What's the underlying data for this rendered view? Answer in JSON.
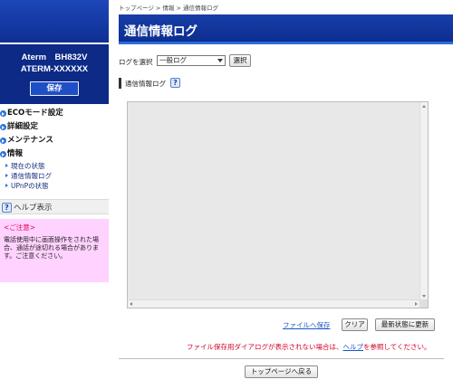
{
  "sidebar": {
    "model_line1": "Aterm　BH832V",
    "model_line2": "ATERM-XXXXXX",
    "save_label": "保存",
    "nav": [
      {
        "label": "ECOモード設定"
      },
      {
        "label": "詳細設定"
      },
      {
        "label": "メンテナンス"
      },
      {
        "label": "情報"
      }
    ],
    "sub_items": [
      {
        "label": "現在の状態"
      },
      {
        "label": "通信情報ログ"
      },
      {
        "label": "UPnPの状態"
      }
    ],
    "help_label": "ヘルプ表示",
    "help_icon": "?",
    "notice": {
      "title": "<ご注意>",
      "body": "電話使用中に画面操作をされた場合、通話が途切れる場合があります。ご注意ください。"
    }
  },
  "breadcrumb": "トップページ > 情報 > 通信情報ログ",
  "page_title": "通信情報ログ",
  "log_select": {
    "label": "ログを選択",
    "selected": "一般ログ",
    "button": "選択"
  },
  "section": {
    "label": "通信情報ログ",
    "help_icon": "?"
  },
  "log_content": "",
  "actions": {
    "save_link": "ファイルへ保存",
    "clear": "クリア",
    "refresh": "最新状態に更新"
  },
  "warning": {
    "prefix": "ファイル保存用ダイアログが表示されない場合は、",
    "link": "ヘルプ",
    "suffix": "を参照してください。"
  },
  "top_button": "トップページへ戻る",
  "colors": {
    "header_blue": "#0c2c8e",
    "nav_bullet": "#2a73d9",
    "notice_bg": "#ffd2ff",
    "warning_red": "#d4002a",
    "link_blue": "#1d57c7"
  }
}
